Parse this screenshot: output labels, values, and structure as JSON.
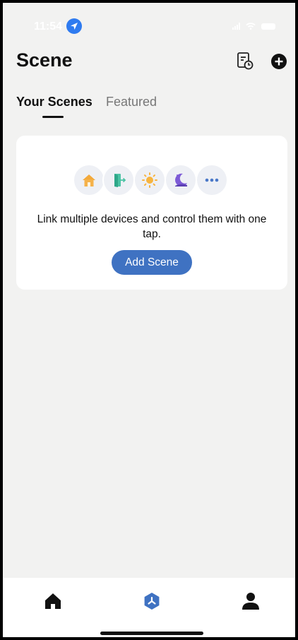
{
  "status_bar": {
    "time": "11:54"
  },
  "header": {
    "title": "Scene"
  },
  "tabs": [
    {
      "label": "Your Scenes",
      "active": true
    },
    {
      "label": "Featured",
      "active": false
    }
  ],
  "empty_state": {
    "message": "Link multiple devices and control them with one tap.",
    "button_label": "Add Scene",
    "icons": [
      "home-icon",
      "door-exit-icon",
      "sun-icon",
      "moon-sleep-icon",
      "more-icon"
    ]
  },
  "bottom_nav": {
    "items": [
      "home-tab",
      "scene-tab",
      "profile-tab"
    ],
    "active": "scene-tab"
  },
  "colors": {
    "accent": "#3f72c2",
    "background": "#f2f2f1",
    "card": "#ffffff"
  }
}
